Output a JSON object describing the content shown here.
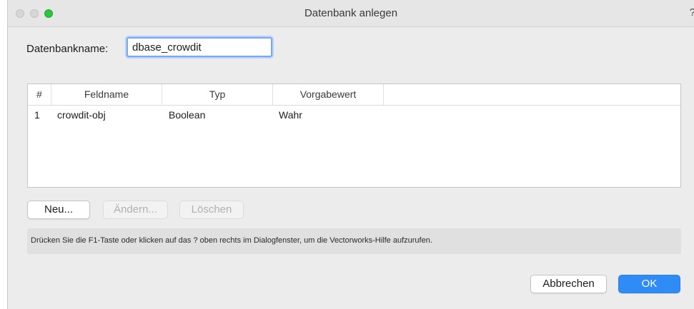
{
  "window": {
    "title": "Datenbank anlegen",
    "help_symbol": "?"
  },
  "form": {
    "name_label": "Datenbankname:",
    "name_value": "dbase_crowdit"
  },
  "table": {
    "columns": [
      "#",
      "Feldname",
      "Typ",
      "Vorgabewert"
    ],
    "rows": [
      {
        "num": "1",
        "feldname": "crowdit-obj",
        "typ": "Boolean",
        "vorgabewert": "Wahr"
      }
    ]
  },
  "buttons": {
    "new": "Neu...",
    "edit": "Ändern...",
    "delete": "Löschen",
    "cancel": "Abbrechen",
    "ok": "OK"
  },
  "hint": "Drücken Sie die F1-Taste oder klicken auf das ? oben rechts im Dialogfenster, um die Vectorworks-Hilfe aufzurufen.",
  "colors": {
    "accent": "#2f8cf7",
    "zoom_button": "#2dc43f",
    "focus_ring": "#7aa8ec"
  }
}
